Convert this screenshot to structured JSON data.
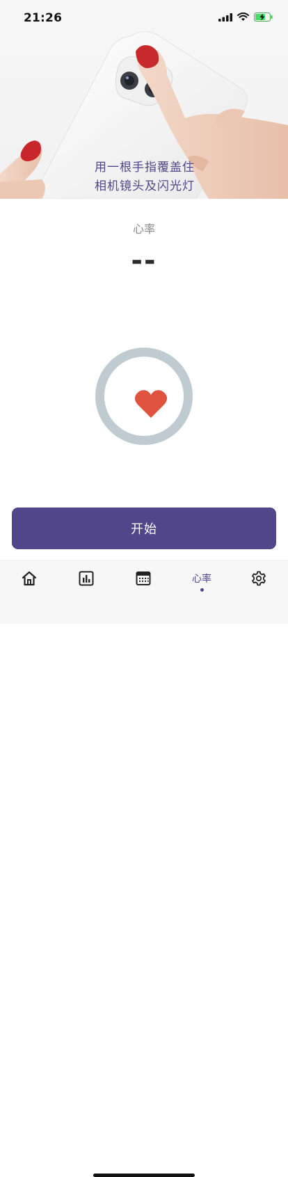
{
  "status_bar": {
    "time": "21:26"
  },
  "hero": {
    "caption_lines": [
      "用一根手指覆盖住",
      "相机镜头及闪光灯"
    ]
  },
  "metric": {
    "label": "心率",
    "value": "--"
  },
  "start_button": {
    "label": "开始"
  },
  "tab_bar": {
    "active_label": "心率",
    "icons": [
      "home-icon",
      "bar-chart-icon",
      "calendar-icon",
      "heart-rate-tab",
      "gear-icon"
    ]
  },
  "colors": {
    "accent": "#51468a",
    "heart": "#e0533f",
    "ring": "#bfcbd0"
  }
}
